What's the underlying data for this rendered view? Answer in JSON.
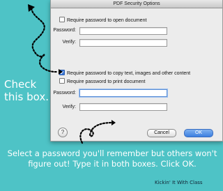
{
  "dialog": {
    "title": "PDF Security Options",
    "open_checkbox_label": "Require password to open document",
    "open_password_label": "Password:",
    "open_verify_label": "Verify:",
    "copy_checkbox_label": "Require password to copy text, images and other content",
    "print_checkbox_label": "Require password to print document",
    "copy_password_label": "Password:",
    "copy_verify_label": "Verify:",
    "help_label": "?",
    "cancel_label": "Cancel",
    "ok_label": "OK"
  },
  "annotations": {
    "check_note": "Check this box.",
    "instructions": "Select a password you'll remember but others won't figure out! Type it in both boxes. Click OK.",
    "credit": "Kickin' It With Class"
  },
  "colors": {
    "background": "#4ec3c6",
    "ok_button": "#3c7fe0"
  }
}
